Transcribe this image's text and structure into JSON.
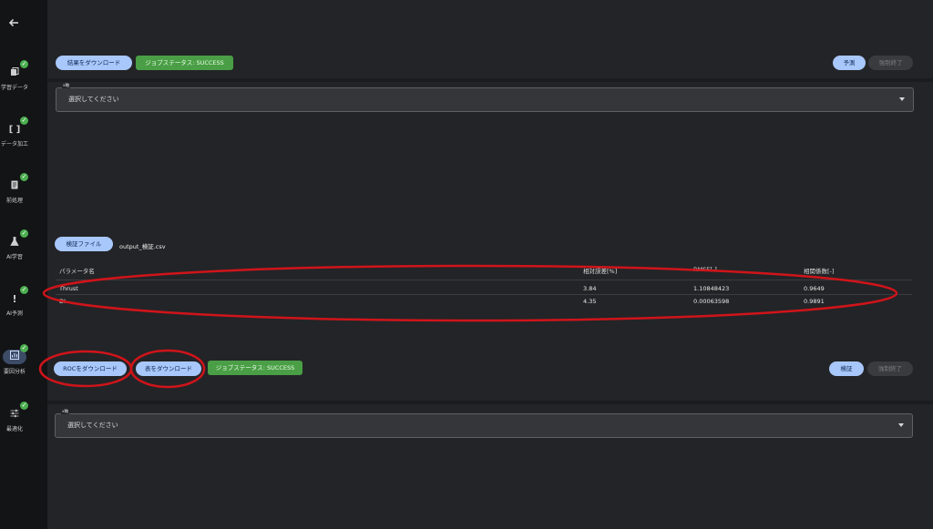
{
  "sidebar": {
    "back_icon": "arrow-left-icon",
    "items": [
      {
        "label": "学習データ",
        "icon": "copy-icon",
        "checked": true
      },
      {
        "label": "データ加工",
        "icon": "brackets-icon",
        "checked": true
      },
      {
        "label": "前処理",
        "icon": "document-icon",
        "checked": true
      },
      {
        "label": "AI学習",
        "icon": "flask-icon",
        "checked": true
      },
      {
        "label": "AI予測",
        "icon": "exclamation-icon",
        "checked": true
      },
      {
        "label": "要因分析",
        "icon": "chart-icon",
        "checked": true,
        "active": true
      },
      {
        "label": "最適化",
        "icon": "sliders-icon",
        "checked": true
      }
    ]
  },
  "predict_section": {
    "download_results": "結果をダウンロード",
    "job_status": "ジョブステータス: SUCCESS",
    "predict_button": "予測",
    "force_stop": "強制終了",
    "xaxis_legend": "x軸",
    "xaxis_placeholder": "選択してください"
  },
  "verify_section": {
    "verify_file_button": "検証ファイル",
    "file_name": "output_検証.csv",
    "table": {
      "headers": [
        "パラメータ名",
        "相対誤差[%]",
        "RMSE[-]",
        "相関係数[-]"
      ],
      "rows": [
        [
          "Thrust",
          "3.84",
          "1.10848423",
          "0.9649"
        ],
        [
          "DI",
          "4.35",
          "0.00063598",
          "0.9891"
        ]
      ]
    },
    "download_roc": "ROCをダウンロード",
    "download_table": "表をダウンロード",
    "job_status": "ジョブステータス: SUCCESS",
    "verify_button": "検証",
    "force_stop": "強制終了",
    "xaxis_legend": "x軸",
    "xaxis_placeholder": "選択してください"
  },
  "colors": {
    "accent_blue": "#a8c7fa",
    "success_green": "#4a9e45",
    "annotation_red": "#d0141a"
  }
}
